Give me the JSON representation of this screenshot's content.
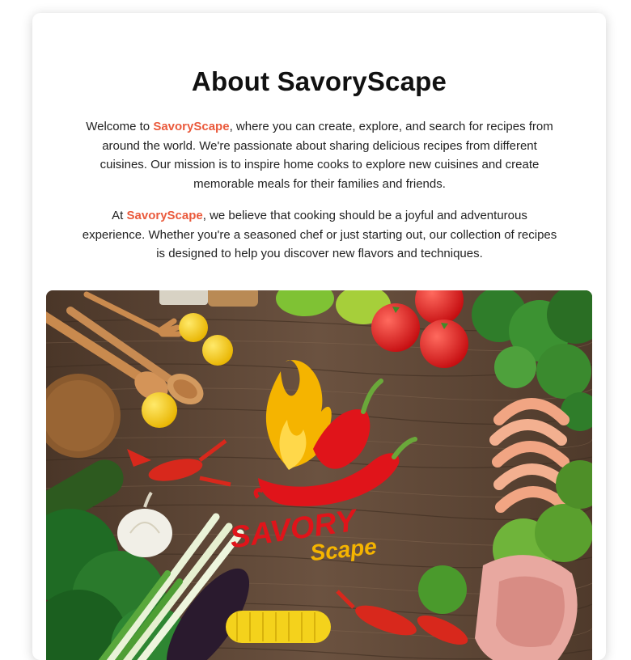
{
  "about": {
    "title": "About SavoryScape",
    "paragraph1": {
      "before": "Welcome to ",
      "brand": "SavoryScape",
      "after": ", where you can create, explore, and search for recipes from around the world. We're passionate about sharing delicious recipes from different cuisines. Our mission is to inspire home cooks to explore new cuisines and create memorable meals for their families and friends."
    },
    "paragraph2": {
      "before": "At ",
      "brand": "SavoryScape",
      "after": ", we believe that cooking should be a joyful and adventurous experience. Whether you're a seasoned chef or just starting out, our collection of recipes is designed to help you discover new flavors and techniques."
    }
  },
  "hero": {
    "logo_word1": "SAVORY",
    "logo_word2": "Scape"
  },
  "colors": {
    "brand": "#ea5a3c",
    "logo_red": "#e0141a",
    "logo_yellow": "#f5b400",
    "wood": "#5b4433"
  }
}
